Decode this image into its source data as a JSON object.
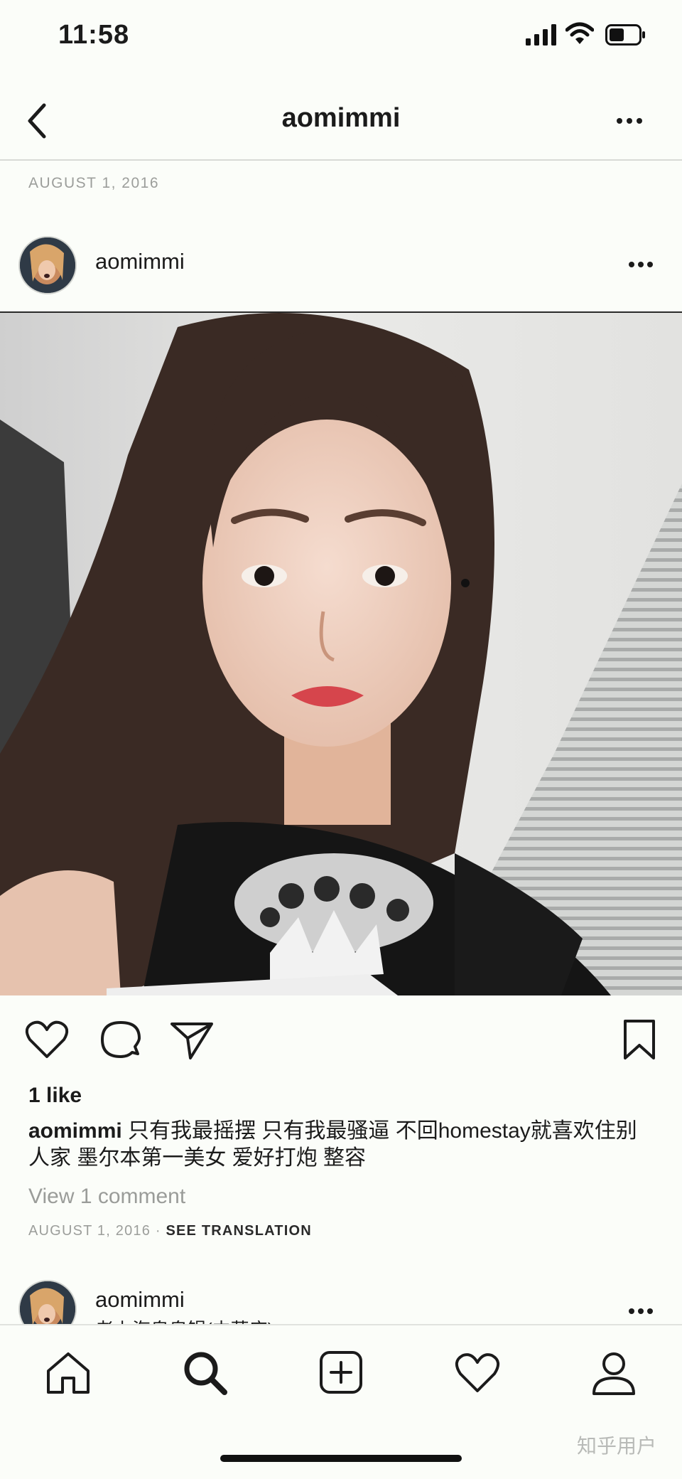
{
  "status_bar": {
    "time": "11:58"
  },
  "nav": {
    "title": "aomimmi"
  },
  "post": {
    "date_top": "AUGUST 1, 2016",
    "username": "aomimmi",
    "likes": "1 like",
    "caption_user": "aomimmi",
    "caption_text": " 只有我最摇摆 只有我最骚逼 不回homestay就喜欢住别人家 墨尔本第一美女 爱好打炮 整容",
    "view_comments": "View 1 comment",
    "date_bottom": "AUGUST 1, 2016",
    "meta_separator": " · ",
    "see_translation": "SEE TRANSLATION"
  },
  "next_post": {
    "username": "aomimmi",
    "location": "老上海皇皇锅(中華店)"
  },
  "watermark": "知乎用户",
  "icons": {
    "back": "chevron-left-icon",
    "more": "more-horizontal-icon",
    "like": "heart-icon",
    "comment": "comment-bubble-icon",
    "share": "send-icon",
    "save": "bookmark-icon",
    "home": "home-icon",
    "search": "search-icon",
    "new_post": "plus-square-icon",
    "activity": "heart-icon",
    "profile": "user-icon"
  }
}
